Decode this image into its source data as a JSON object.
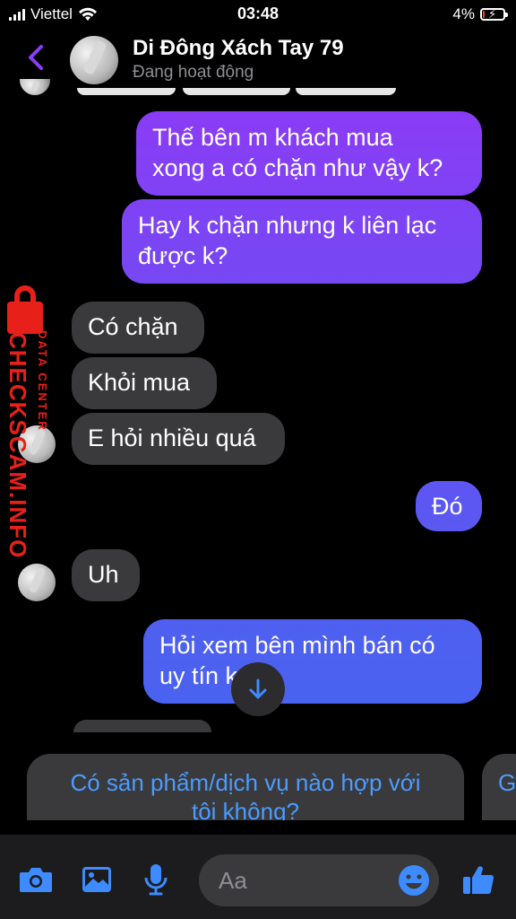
{
  "status_bar": {
    "carrier": "Viettel",
    "time": "03:48",
    "battery": "4%",
    "battery_level": 0.04
  },
  "header": {
    "contact_name": "Di Đông Xách Tay 79",
    "presence": "Đang hoạt động"
  },
  "watermark": {
    "brand": "CHECKSCAM.INFO",
    "sub": "DATA CENTER"
  },
  "messages": [
    {
      "side": "out",
      "lines": [
        "Thế bên m khách mua",
        "xong a có chặn như vậy k?"
      ]
    },
    {
      "side": "out",
      "lines": [
        "Hay k chặn nhưng k liên lạc",
        "được k?"
      ]
    },
    {
      "side": "in",
      "text": "Có chặn"
    },
    {
      "side": "in",
      "text": "Khỏi mua"
    },
    {
      "side": "in",
      "text": "E hỏi nhiều quá"
    },
    {
      "side": "out",
      "text": "Đó"
    },
    {
      "side": "in",
      "text": "Uh"
    },
    {
      "side": "out",
      "lines": [
        "Hỏi xem bên mình bán có",
        "uy tín k"
      ]
    }
  ],
  "suggestions": [
    {
      "lines": [
        "Có sản phẩm/dịch vụ nào hợp với",
        "tôi không?"
      ]
    },
    {
      "lines": [
        "G"
      ]
    }
  ],
  "composer": {
    "placeholder": "Aa"
  },
  "colors": {
    "out_bubble_top": "#8a3cf5",
    "out_bubble_bottom": "#4a62f0",
    "in_bubble": "#3a3a3c",
    "accent": "#3d8bff",
    "watermark": "#e8201a"
  }
}
